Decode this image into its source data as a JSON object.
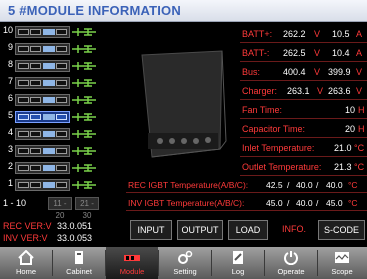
{
  "title": "5 #MODULE INFORMATION",
  "modules": [
    {
      "num": "10",
      "selected": false
    },
    {
      "num": "9",
      "selected": false
    },
    {
      "num": "8",
      "selected": false
    },
    {
      "num": "7",
      "selected": false
    },
    {
      "num": "6",
      "selected": false
    },
    {
      "num": "5",
      "selected": true
    },
    {
      "num": "4",
      "selected": false
    },
    {
      "num": "3",
      "selected": false
    },
    {
      "num": "2",
      "selected": false
    },
    {
      "num": "1",
      "selected": false
    }
  ],
  "pager": {
    "current": "1 - 10",
    "p2": "11 - 20",
    "p3": "21 - 30"
  },
  "params": {
    "batt_pos": {
      "label": "BATT+:",
      "v1": "262.2",
      "u1": "V",
      "v2": "10.5",
      "u2": "A"
    },
    "batt_neg": {
      "label": "BATT-:",
      "v1": "262.5",
      "u1": "V",
      "v2": "10.4",
      "u2": "A"
    },
    "bus": {
      "label": "Bus:",
      "v1": "400.4",
      "u1": "V",
      "v2": "399.9",
      "u2": "V"
    },
    "charger": {
      "label": "Charger:",
      "v1": "263.1",
      "u1": "V",
      "v2": "263.6",
      "u2": "V"
    },
    "fan_time": {
      "label": "Fan Time:",
      "v": "10",
      "u": "H"
    },
    "capacitor_time": {
      "label": "Capacitor Time:",
      "v": "20",
      "u": "H"
    },
    "inlet_temp": {
      "label": "Inlet Temperature:",
      "v": "21.0",
      "u": "°C"
    },
    "outlet_temp": {
      "label": "Outlet Temperature:",
      "v": "21.3",
      "u": "°C"
    }
  },
  "igbt": {
    "rec": {
      "label": "REC IGBT Temperature(A/B/C):",
      "a": "42.5",
      "b": "40.0",
      "c": "40.0",
      "sep": "/",
      "unit": "°C"
    },
    "inv": {
      "label": "INV IGBT Temperature(A/B/C):",
      "a": "45.0",
      "b": "40.0",
      "c": "45.0",
      "sep": "/",
      "unit": "°C"
    }
  },
  "versions": {
    "rec": {
      "label": "REC VER:V",
      "value": "33.0.051"
    },
    "inv": {
      "label": "INV VER:V",
      "value": "33.0.053"
    }
  },
  "buttons": {
    "input": "INPUT",
    "output": "OUTPUT",
    "load": "LOAD",
    "info": "INFO.",
    "scode": "S-CODE"
  },
  "nav": [
    {
      "label": "Home",
      "icon": "home-icon"
    },
    {
      "label": "Cabinet",
      "icon": "cabinet-icon"
    },
    {
      "label": "Module",
      "icon": "module-icon",
      "active": true
    },
    {
      "label": "Setting",
      "icon": "gear-icon"
    },
    {
      "label": "Log",
      "icon": "log-icon"
    },
    {
      "label": "Operate",
      "icon": "power-icon"
    },
    {
      "label": "Scope",
      "icon": "scope-icon"
    }
  ],
  "colors": {
    "accent": "#ff3a3a",
    "title": "#3b62b8",
    "background": "#000000",
    "selected": "#1a3a8a"
  }
}
